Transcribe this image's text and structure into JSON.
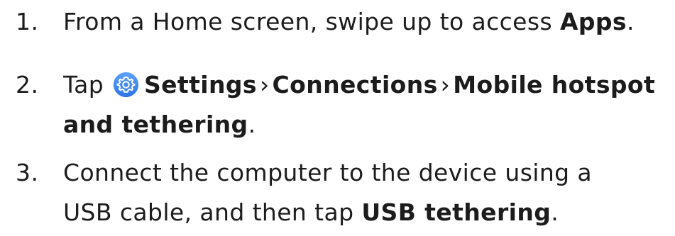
{
  "steps": [
    {
      "number": "1.",
      "text_before": "From a Home screen, swipe up to access ",
      "bold": "Apps",
      "text_after": "."
    },
    {
      "number": "2.",
      "tap": "Tap",
      "icon": "settings-gear-icon",
      "icon_color": "#3f8cf0",
      "path": [
        "Settings",
        "Connections",
        "Mobile hotspot"
      ],
      "separator": "›",
      "line2_bold": "and tethering",
      "line2_after": "."
    },
    {
      "number": "3.",
      "line1": "Connect the computer to the device using a",
      "line2_before": "USB cable, and then tap ",
      "line2_bold": "USB tethering",
      "line2_after": "."
    }
  ]
}
